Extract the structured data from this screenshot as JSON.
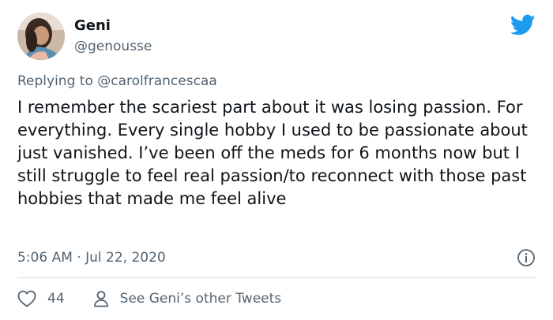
{
  "author": {
    "display_name": "Geni",
    "handle": "@genousse"
  },
  "reply": {
    "prefix": "Replying to",
    "to_handle": "@carolfrancescaa"
  },
  "tweet": {
    "text": "I remember the scariest part about it was losing passion. For everything. Every single hobby I used to be passionate about just vanished. I’ve been off the meds for 6 months now but I still struggle to feel real passion/to reconnect with those past hobbies that made me feel alive",
    "timestamp": "5:06 AM · Jul 22, 2020"
  },
  "actions": {
    "like_count": "44",
    "profile_link_label": "See Geni’s other Tweets"
  },
  "icons": {
    "brand": "twitter-bird-icon",
    "info": "info-icon",
    "like": "heart-icon",
    "profile": "person-icon"
  },
  "colors": {
    "brand": "#1d9bf0",
    "text_primary": "#0f1419",
    "text_secondary": "#536471",
    "divider": "#cfd9de"
  }
}
